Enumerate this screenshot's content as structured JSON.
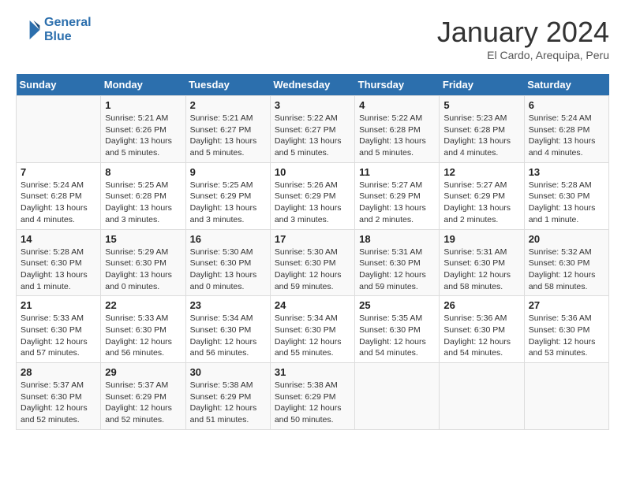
{
  "header": {
    "logo_line1": "General",
    "logo_line2": "Blue",
    "month": "January 2024",
    "location": "El Cardo, Arequipa, Peru"
  },
  "days_of_week": [
    "Sunday",
    "Monday",
    "Tuesday",
    "Wednesday",
    "Thursday",
    "Friday",
    "Saturday"
  ],
  "weeks": [
    [
      {
        "date": "",
        "info": ""
      },
      {
        "date": "1",
        "info": "Sunrise: 5:21 AM\nSunset: 6:26 PM\nDaylight: 13 hours\nand 5 minutes."
      },
      {
        "date": "2",
        "info": "Sunrise: 5:21 AM\nSunset: 6:27 PM\nDaylight: 13 hours\nand 5 minutes."
      },
      {
        "date": "3",
        "info": "Sunrise: 5:22 AM\nSunset: 6:27 PM\nDaylight: 13 hours\nand 5 minutes."
      },
      {
        "date": "4",
        "info": "Sunrise: 5:22 AM\nSunset: 6:28 PM\nDaylight: 13 hours\nand 5 minutes."
      },
      {
        "date": "5",
        "info": "Sunrise: 5:23 AM\nSunset: 6:28 PM\nDaylight: 13 hours\nand 4 minutes."
      },
      {
        "date": "6",
        "info": "Sunrise: 5:24 AM\nSunset: 6:28 PM\nDaylight: 13 hours\nand 4 minutes."
      }
    ],
    [
      {
        "date": "7",
        "info": "Sunrise: 5:24 AM\nSunset: 6:28 PM\nDaylight: 13 hours\nand 4 minutes."
      },
      {
        "date": "8",
        "info": "Sunrise: 5:25 AM\nSunset: 6:28 PM\nDaylight: 13 hours\nand 3 minutes."
      },
      {
        "date": "9",
        "info": "Sunrise: 5:25 AM\nSunset: 6:29 PM\nDaylight: 13 hours\nand 3 minutes."
      },
      {
        "date": "10",
        "info": "Sunrise: 5:26 AM\nSunset: 6:29 PM\nDaylight: 13 hours\nand 3 minutes."
      },
      {
        "date": "11",
        "info": "Sunrise: 5:27 AM\nSunset: 6:29 PM\nDaylight: 13 hours\nand 2 minutes."
      },
      {
        "date": "12",
        "info": "Sunrise: 5:27 AM\nSunset: 6:29 PM\nDaylight: 13 hours\nand 2 minutes."
      },
      {
        "date": "13",
        "info": "Sunrise: 5:28 AM\nSunset: 6:30 PM\nDaylight: 13 hours\nand 1 minute."
      }
    ],
    [
      {
        "date": "14",
        "info": "Sunrise: 5:28 AM\nSunset: 6:30 PM\nDaylight: 13 hours\nand 1 minute."
      },
      {
        "date": "15",
        "info": "Sunrise: 5:29 AM\nSunset: 6:30 PM\nDaylight: 13 hours\nand 0 minutes."
      },
      {
        "date": "16",
        "info": "Sunrise: 5:30 AM\nSunset: 6:30 PM\nDaylight: 13 hours\nand 0 minutes."
      },
      {
        "date": "17",
        "info": "Sunrise: 5:30 AM\nSunset: 6:30 PM\nDaylight: 12 hours\nand 59 minutes."
      },
      {
        "date": "18",
        "info": "Sunrise: 5:31 AM\nSunset: 6:30 PM\nDaylight: 12 hours\nand 59 minutes."
      },
      {
        "date": "19",
        "info": "Sunrise: 5:31 AM\nSunset: 6:30 PM\nDaylight: 12 hours\nand 58 minutes."
      },
      {
        "date": "20",
        "info": "Sunrise: 5:32 AM\nSunset: 6:30 PM\nDaylight: 12 hours\nand 58 minutes."
      }
    ],
    [
      {
        "date": "21",
        "info": "Sunrise: 5:33 AM\nSunset: 6:30 PM\nDaylight: 12 hours\nand 57 minutes."
      },
      {
        "date": "22",
        "info": "Sunrise: 5:33 AM\nSunset: 6:30 PM\nDaylight: 12 hours\nand 56 minutes."
      },
      {
        "date": "23",
        "info": "Sunrise: 5:34 AM\nSunset: 6:30 PM\nDaylight: 12 hours\nand 56 minutes."
      },
      {
        "date": "24",
        "info": "Sunrise: 5:34 AM\nSunset: 6:30 PM\nDaylight: 12 hours\nand 55 minutes."
      },
      {
        "date": "25",
        "info": "Sunrise: 5:35 AM\nSunset: 6:30 PM\nDaylight: 12 hours\nand 54 minutes."
      },
      {
        "date": "26",
        "info": "Sunrise: 5:36 AM\nSunset: 6:30 PM\nDaylight: 12 hours\nand 54 minutes."
      },
      {
        "date": "27",
        "info": "Sunrise: 5:36 AM\nSunset: 6:30 PM\nDaylight: 12 hours\nand 53 minutes."
      }
    ],
    [
      {
        "date": "28",
        "info": "Sunrise: 5:37 AM\nSunset: 6:30 PM\nDaylight: 12 hours\nand 52 minutes."
      },
      {
        "date": "29",
        "info": "Sunrise: 5:37 AM\nSunset: 6:29 PM\nDaylight: 12 hours\nand 52 minutes."
      },
      {
        "date": "30",
        "info": "Sunrise: 5:38 AM\nSunset: 6:29 PM\nDaylight: 12 hours\nand 51 minutes."
      },
      {
        "date": "31",
        "info": "Sunrise: 5:38 AM\nSunset: 6:29 PM\nDaylight: 12 hours\nand 50 minutes."
      },
      {
        "date": "",
        "info": ""
      },
      {
        "date": "",
        "info": ""
      },
      {
        "date": "",
        "info": ""
      }
    ]
  ]
}
